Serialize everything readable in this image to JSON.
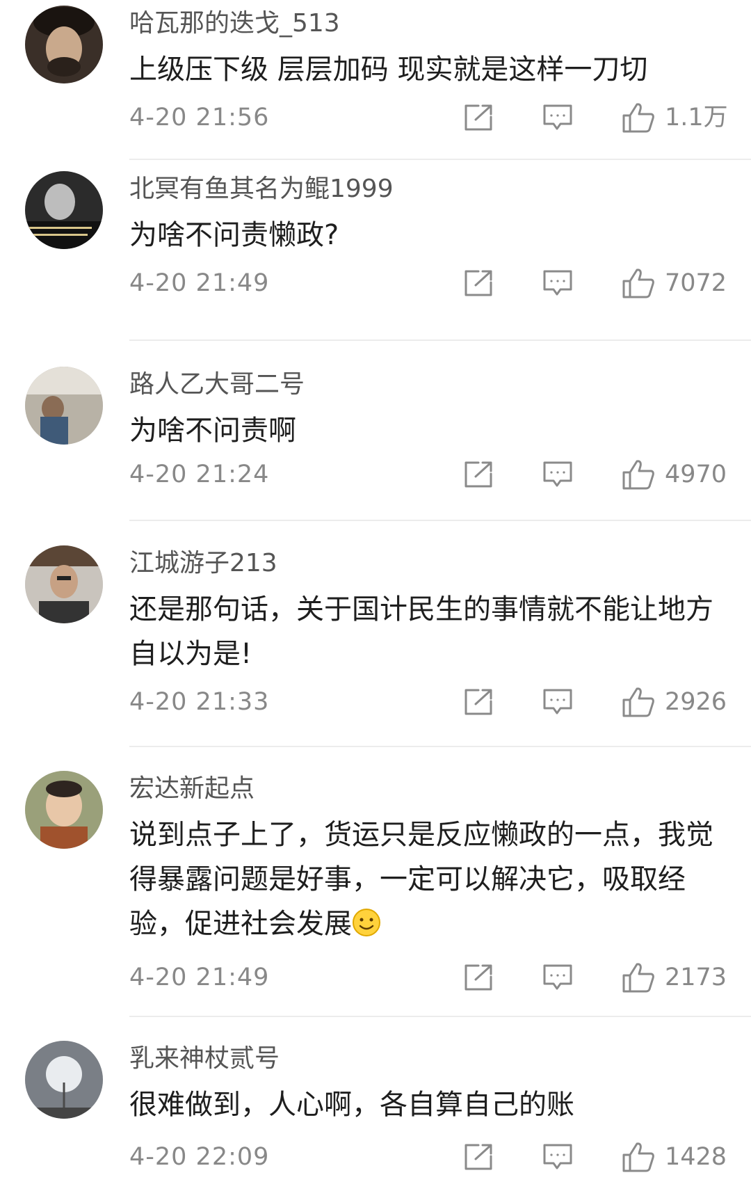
{
  "comments": [
    {
      "username": "哈瓦那的迭戈_513",
      "text": "上级压下级 层层加码 现实就是这样一刀切",
      "time": "4-20 21:56",
      "likes": "1.1万",
      "avatar": "portrait-beret"
    },
    {
      "username": "北冥有鱼其名为鲲1999",
      "text": "为啥不问责懒政?",
      "time": "4-20 21:49",
      "likes": "7072",
      "avatar": "portrait-elder-with-caption"
    },
    {
      "username": "路人乙大哥二号",
      "text": "为啥不问责啊",
      "time": "4-20 21:24",
      "likes": "4970",
      "avatar": "monk-in-courtyard"
    },
    {
      "username": "江城游子213",
      "text": "还是那句话，关于国计民生的事情就不能让地方自以为是!",
      "time": "4-20 21:33",
      "likes": "2926",
      "avatar": "man-with-glasses"
    },
    {
      "username": "宏达新起点",
      "text": "说到点子上了，货运只是反应懒政的一点，我觉得暴露问题是好事，一定可以解决它，吸取经验，促进社会发展",
      "emoji": "smiley-emoji",
      "time": "4-20 21:49",
      "likes": "2173",
      "avatar": "child-portrait"
    },
    {
      "username": "乳来神杖贰号",
      "text": "很难做到，人心啊，各自算自己的账",
      "time": "4-20 22:09",
      "likes": "1428",
      "avatar": "dandelion-photo"
    }
  ],
  "icons": {
    "share": "share-icon",
    "reply": "reply-icon",
    "like": "thumbs-up-icon"
  },
  "colors": {
    "meta_text": "#888888",
    "body_text": "#1e1e1e",
    "username": "#555555",
    "divider": "#ececec"
  }
}
